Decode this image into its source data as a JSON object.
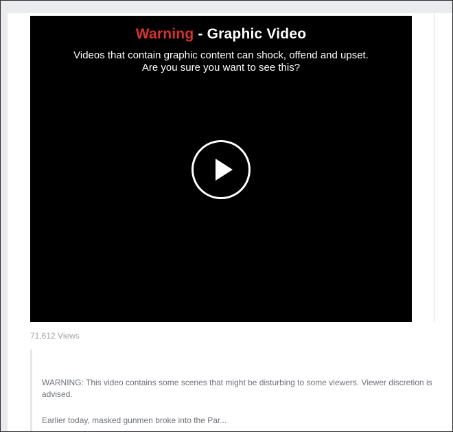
{
  "video": {
    "title_warning": "Warning",
    "title_rest": " - Graphic Video",
    "body_line1": "Videos that contain graphic content can shock, offend and upset.",
    "body_line2": "Are you sure you want to see this?",
    "play_icon": "play-icon",
    "warning_color": "#d9322e"
  },
  "stats": {
    "views": "71,612 Views"
  },
  "description": {
    "warning_text": "WARNING: This video contains some scenes that might be disturbing to some viewers. Viewer discretion is advised.",
    "preview_text": "Earlier today, masked gunmen broke into the Par..."
  }
}
